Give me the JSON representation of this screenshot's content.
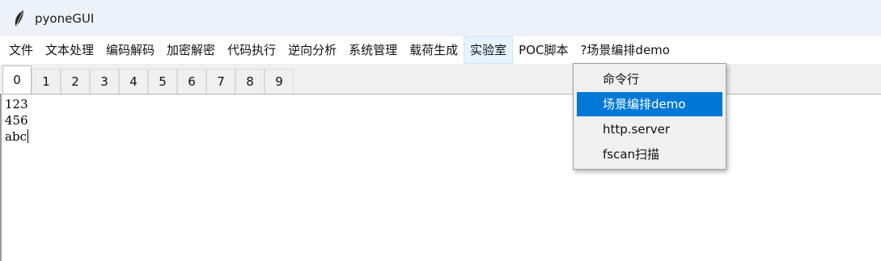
{
  "window": {
    "title": "pyoneGUI",
    "icon": "feather-icon"
  },
  "menubar": {
    "items": [
      {
        "label": "文件"
      },
      {
        "label": "文本处理"
      },
      {
        "label": "编码解码"
      },
      {
        "label": "加密解密"
      },
      {
        "label": "代码执行"
      },
      {
        "label": "逆向分析"
      },
      {
        "label": "系统管理"
      },
      {
        "label": "载荷生成"
      },
      {
        "label": "实验室"
      },
      {
        "label": "POC脚本"
      },
      {
        "label": "?场景编排demo"
      }
    ],
    "active_index": 8
  },
  "tabs": {
    "items": [
      {
        "label": "0"
      },
      {
        "label": "1"
      },
      {
        "label": "2"
      },
      {
        "label": "3"
      },
      {
        "label": "4"
      },
      {
        "label": "5"
      },
      {
        "label": "6"
      },
      {
        "label": "7"
      },
      {
        "label": "8"
      },
      {
        "label": "9"
      }
    ],
    "selected_index": 0
  },
  "editor": {
    "lines": [
      "123",
      "456",
      "abc"
    ]
  },
  "dropdown": {
    "items": [
      {
        "label": "命令行"
      },
      {
        "label": "场景编排demo"
      },
      {
        "label": "http.server"
      },
      {
        "label": "fscan扫描"
      }
    ],
    "highlighted_index": 1
  },
  "colors": {
    "highlight": "#0078d7",
    "titlebar_bg": "#edf2f9",
    "menubar_bg": "#ffffff"
  }
}
